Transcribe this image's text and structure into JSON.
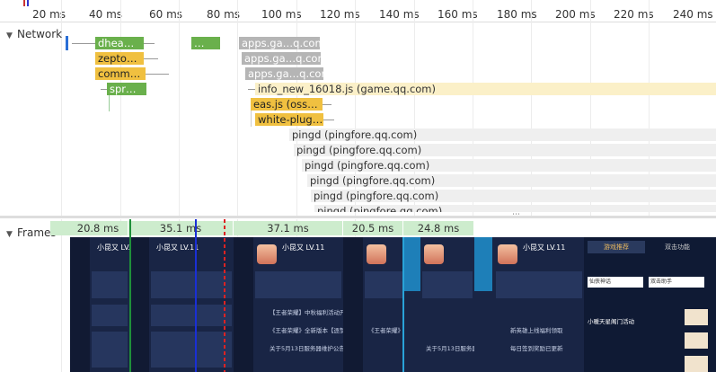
{
  "ruler": {
    "ticks": [
      "20 ms",
      "40 ms",
      "60 ms",
      "80 ms",
      "100 ms",
      "120 ms",
      "140 ms",
      "160 ms",
      "180 ms",
      "200 ms",
      "220 ms",
      "240 ms"
    ]
  },
  "network": {
    "title": "Network",
    "requests": [
      {
        "label": "dhea…",
        "color": "green"
      },
      {
        "label": "…",
        "color": "green"
      },
      {
        "label": "apps.ga…q.com)",
        "color": "gray"
      },
      {
        "label": "zepto…",
        "color": "yellow"
      },
      {
        "label": "apps.ga…q.com)",
        "color": "gray"
      },
      {
        "label": "comm…",
        "color": "yellow"
      },
      {
        "label": "apps.ga…q.com)",
        "color": "gray"
      },
      {
        "label": "spr…",
        "color": "green"
      },
      {
        "label": "info_new_16018.js (game.qq.com)",
        "color": "lightyellow"
      },
      {
        "label": "eas.js (oss…",
        "color": "yellow"
      },
      {
        "label": "white-plug…",
        "color": "yellow"
      },
      {
        "label": "pingd (pingfore.qq.com)",
        "color": "lightgray"
      },
      {
        "label": "pingd (pingfore.qq.com)",
        "color": "lightgray"
      },
      {
        "label": "pingd (pingfore.qq.com)",
        "color": "lightgray"
      },
      {
        "label": "pingd (pingfore.qq.com)",
        "color": "lightgray"
      },
      {
        "label": "pingd (pingfore.qq.com)",
        "color": "lightgray"
      },
      {
        "label": "pingd (pingfore.qq.com)",
        "color": "lightgray"
      }
    ],
    "resize_handle": "⋯"
  },
  "frames": {
    "title": "Frames",
    "durations": [
      "20.8 ms",
      "35.1 ms",
      "37.1 ms",
      "20.5 ms",
      "24.8 ms"
    ],
    "screenshot": {
      "header": "小昆又 LV.11",
      "rows": [
        "【王者荣耀】中秋福利活动开启",
        "《王者荣耀》全新版本【逐梦之夏】",
        "关于5月13日服务器维护公告",
        "新英雄上线福利领取",
        "每日签到奖励已更新"
      ],
      "tabs": [
        "游戏推荐",
        "双击功能"
      ],
      "list": [
        "仙侠神话",
        "双击助手",
        "小暖天星阁门活动"
      ]
    }
  }
}
